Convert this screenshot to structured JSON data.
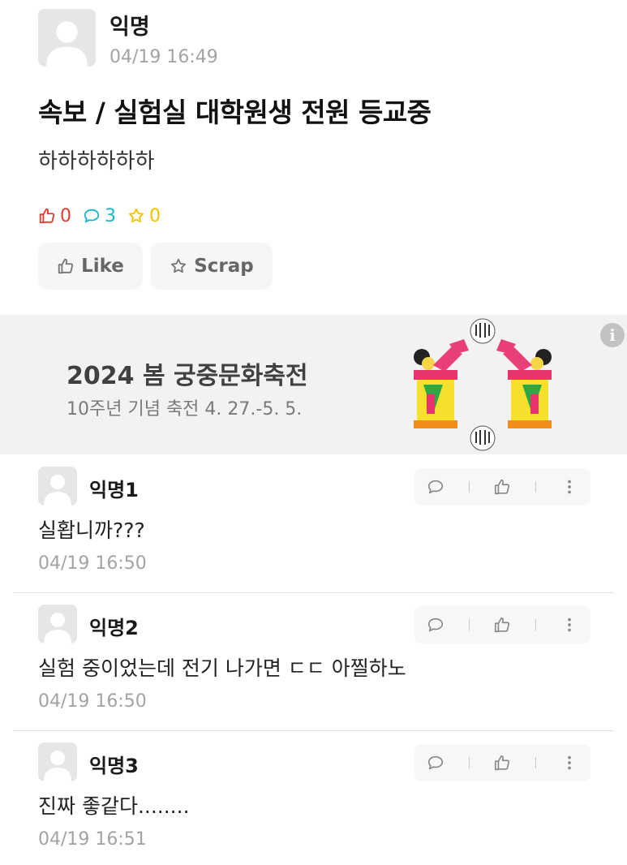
{
  "post": {
    "author": "익명",
    "time": "04/19 16:49",
    "title": "속보 / 실험실 대학원생 전원 등교중",
    "body": "하하하하하하",
    "stats": {
      "likes": "0",
      "comments": "3",
      "scraps": "0"
    },
    "buttons": {
      "like": "Like",
      "scrap": "Scrap"
    }
  },
  "ad": {
    "title": "2024 봄 궁중문화축전",
    "subtitle": "10주년 기념 축전 4. 27.-5. 5.",
    "info_icon": "i"
  },
  "comments": [
    {
      "author": "익명1",
      "text": "실홥니까???",
      "time": "04/19 16:50"
    },
    {
      "author": "익명2",
      "text": "실험 중이었는데 전기 나가면 ㄷㄷ 아찔하노",
      "time": "04/19 16:50"
    },
    {
      "author": "익명3",
      "text": "진짜 좋같다........",
      "time": "04/19 16:51"
    }
  ],
  "colors": {
    "like": "#e53b2f",
    "comment": "#19b8c9",
    "scrap": "#f2c200"
  }
}
